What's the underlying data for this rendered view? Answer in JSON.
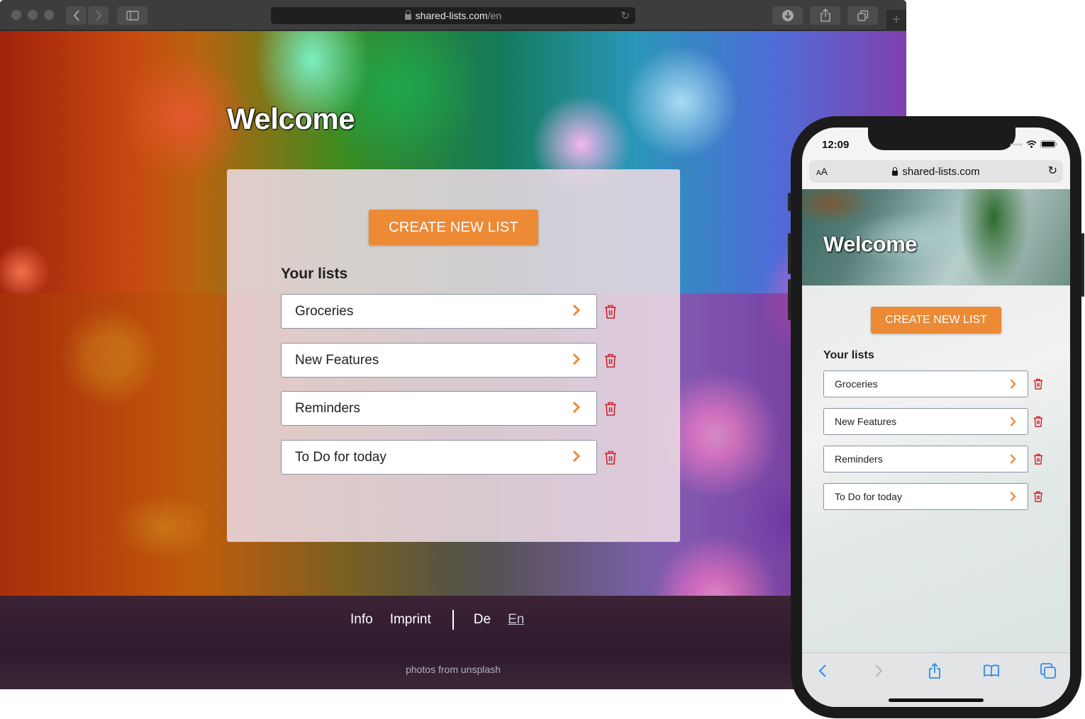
{
  "desktop": {
    "browser": {
      "url_host": "shared-lists.com",
      "url_path": "/en",
      "icons": {
        "back": "chevron-left-icon",
        "forward": "chevron-right-icon",
        "sidebar": "sidebar-icon",
        "lock": "lock-icon",
        "reload": "reload-icon",
        "downloads": "download-icon",
        "share": "share-icon",
        "tabs": "tabs-icon",
        "new_tab": "plus-icon"
      },
      "new_tab_label": "+"
    },
    "page": {
      "title": "Welcome",
      "create_button": "CREATE NEW LIST",
      "lists_heading": "Your lists",
      "lists": [
        {
          "name": "Groceries"
        },
        {
          "name": "New Features"
        },
        {
          "name": "Reminders"
        },
        {
          "name": "To Do for today"
        }
      ],
      "footer": {
        "links": [
          "Info",
          "Imprint"
        ],
        "languages": [
          {
            "label": "De",
            "active": false
          },
          {
            "label": "En",
            "active": true
          }
        ],
        "credit": "photos from unsplash"
      }
    }
  },
  "mobile": {
    "status_bar": {
      "time": "12:09"
    },
    "browser": {
      "text_size_label_small": "A",
      "text_size_label_large": "A",
      "url": "shared-lists.com"
    },
    "page": {
      "title": "Welcome",
      "create_button": "CREATE NEW LIST",
      "lists_heading": "Your lists",
      "lists": [
        {
          "name": "Groceries"
        },
        {
          "name": "New Features"
        },
        {
          "name": "Reminders"
        },
        {
          "name": "To Do for today"
        }
      ]
    },
    "toolbar": [
      "back-icon",
      "forward-icon",
      "share-icon",
      "bookmarks-icon",
      "tabs-icon"
    ]
  },
  "colors": {
    "accent": "#ec8a35",
    "delete": "#d0202a",
    "ios_blue": "#2f8cf0"
  }
}
